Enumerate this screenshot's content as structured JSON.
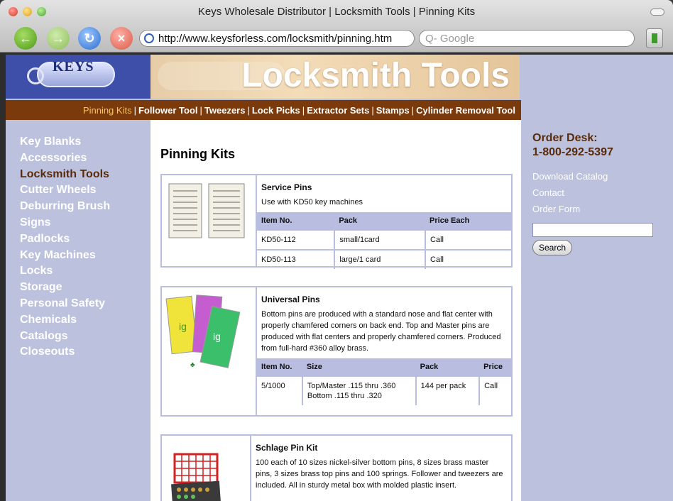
{
  "window": {
    "title": "Keys Wholesale Distributor | Locksmith Tools | Pinning Kits"
  },
  "toolbar": {
    "url": "http://www.keysforless.com/locksmith/pinning.htm",
    "search_placeholder": "Q- Google"
  },
  "header": {
    "logo_text": "KEYS",
    "banner_title": "Locksmith Tools",
    "nav": [
      "Pinning Kits",
      "Follower Tool",
      "Tweezers",
      "Lock Picks",
      "Extractor Sets",
      "Stamps",
      "Cylinder Removal Tool"
    ]
  },
  "sidebar": {
    "items": [
      {
        "label": "Key Blanks"
      },
      {
        "label": "Accessories"
      },
      {
        "label": "Locksmith Tools"
      },
      {
        "label": "Cutter Wheels"
      },
      {
        "label": "Deburring Brush"
      },
      {
        "label": "Signs"
      },
      {
        "label": "Padlocks"
      },
      {
        "label": "Key Machines"
      },
      {
        "label": "Locks"
      },
      {
        "label": "Storage"
      },
      {
        "label": "Personal Safety"
      },
      {
        "label": "Chemicals"
      },
      {
        "label": "Catalogs"
      },
      {
        "label": "Closeouts"
      }
    ]
  },
  "main": {
    "page_title": "Pinning Kits",
    "products": [
      {
        "name": "Service Pins",
        "desc": "Use with KD50 key machines",
        "headers": [
          "Item No.",
          "Pack",
          "Price Each"
        ],
        "rows": [
          [
            "KD50-112",
            "small/1card",
            "Call"
          ],
          [
            "KD50-113",
            "large/1 card",
            "Call"
          ]
        ]
      },
      {
        "name": "Universal Pins",
        "desc": "Bottom pins are produced with a standard nose and flat center with properly chamfered corners on back end. Top and Master pins are produced with flat centers and properly chamfered corners. Produced from full-hard #360 alloy brass.",
        "headers": [
          "Item No.",
          "Size",
          "Pack",
          "Price"
        ],
        "rows": [
          [
            "5/1000",
            "Top/Master .115 thru .360\nBottom .115 thru .320",
            "144 per pack",
            "Call"
          ]
        ]
      },
      {
        "name": "Schlage Pin Kit",
        "desc": "100 each of 10 sizes nickel-silver bottom pins, 8 sizes brass master pins, 3 sizes brass top pins and 100 springs. Follower and tweezers are included. All in sturdy metal box with molded plastic insert."
      }
    ]
  },
  "right": {
    "order_label": "Order Desk:",
    "order_phone": "1-800-292-5397",
    "links": [
      "Download Catalog",
      "Contact",
      "Order Form"
    ],
    "search_button": "Search"
  }
}
